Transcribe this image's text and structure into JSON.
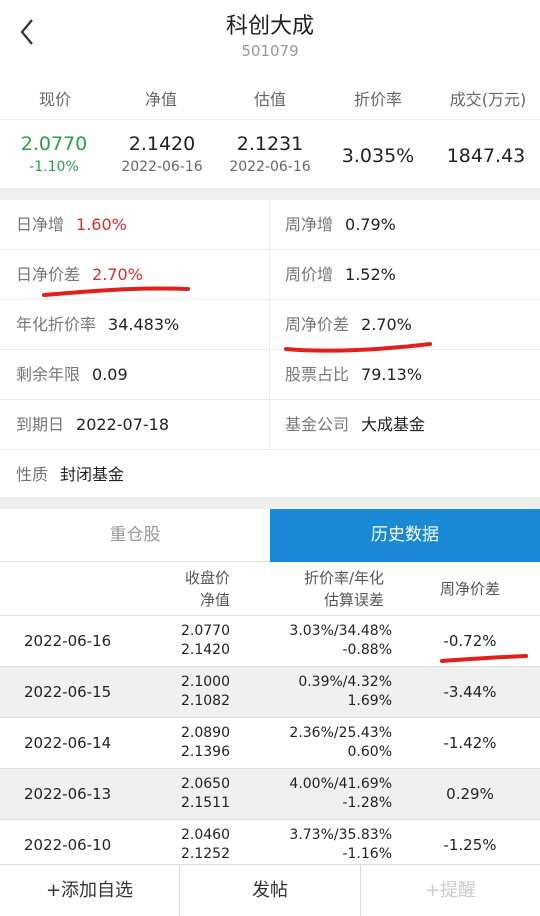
{
  "header": {
    "title": "科创大成",
    "code": "501079"
  },
  "quote": {
    "headers": [
      "现价",
      "净值",
      "估值",
      "折价率",
      "成交(万元)"
    ],
    "price": "2.0770",
    "change": "-1.10%",
    "nav": "2.1420",
    "nav_date": "2022-06-16",
    "est": "2.1231",
    "est_date": "2022-06-16",
    "discount": "3.035%",
    "volume": "1847.43"
  },
  "info": {
    "daily_nav_growth": {
      "label": "日净增",
      "value": "1.60%"
    },
    "weekly_nav_growth": {
      "label": "周净增",
      "value": "0.79%"
    },
    "daily_nav_price_diff": {
      "label": "日净价差",
      "value": "2.70%"
    },
    "weekly_price_growth": {
      "label": "周价增",
      "value": "1.52%"
    },
    "annual_discount": {
      "label": "年化折价率",
      "value": "34.483%"
    },
    "weekly_nav_price_diff": {
      "label": "周净价差",
      "value": "2.70%"
    },
    "remaining_years": {
      "label": "剩余年限",
      "value": "0.09"
    },
    "stock_ratio": {
      "label": "股票占比",
      "value": "79.13%"
    },
    "maturity": {
      "label": "到期日",
      "value": "2022-07-18"
    },
    "company": {
      "label": "基金公司",
      "value": "大成基金"
    },
    "nature": {
      "label": "性质",
      "value": "封闭基金"
    }
  },
  "tabs": {
    "holdings": "重仓股",
    "history": "历史数据"
  },
  "table": {
    "head_price_1": "收盘价",
    "head_price_2": "净值",
    "head_disc_1": "折价率/年化",
    "head_disc_2": "估算误差",
    "head_week": "周净价差",
    "rows": [
      {
        "date": "2022-06-16",
        "close": "2.0770",
        "nav": "2.1420",
        "disc": "3.03%/34.48%",
        "err": "-0.88%",
        "week": "-0.72%"
      },
      {
        "date": "2022-06-15",
        "close": "2.1000",
        "nav": "2.1082",
        "disc": "0.39%/4.32%",
        "err": "1.69%",
        "week": "-3.44%"
      },
      {
        "date": "2022-06-14",
        "close": "2.0890",
        "nav": "2.1396",
        "disc": "2.36%/25.43%",
        "err": "0.60%",
        "week": "-1.42%"
      },
      {
        "date": "2022-06-13",
        "close": "2.0650",
        "nav": "2.1511",
        "disc": "4.00%/41.69%",
        "err": "-1.28%",
        "week": "0.29%"
      },
      {
        "date": "2022-06-10",
        "close": "2.0460",
        "nav": "2.1252",
        "disc": "3.73%/35.83%",
        "err": "-1.16%",
        "week": "-1.25%"
      }
    ]
  },
  "bottom": {
    "add": "+添加自选",
    "post": "发帖",
    "remind": "+提醒"
  },
  "colors": {
    "accent": "#1a8ad6",
    "up": "#e02b2b",
    "down": "#2e9e4a",
    "marker": "#e0201c"
  }
}
